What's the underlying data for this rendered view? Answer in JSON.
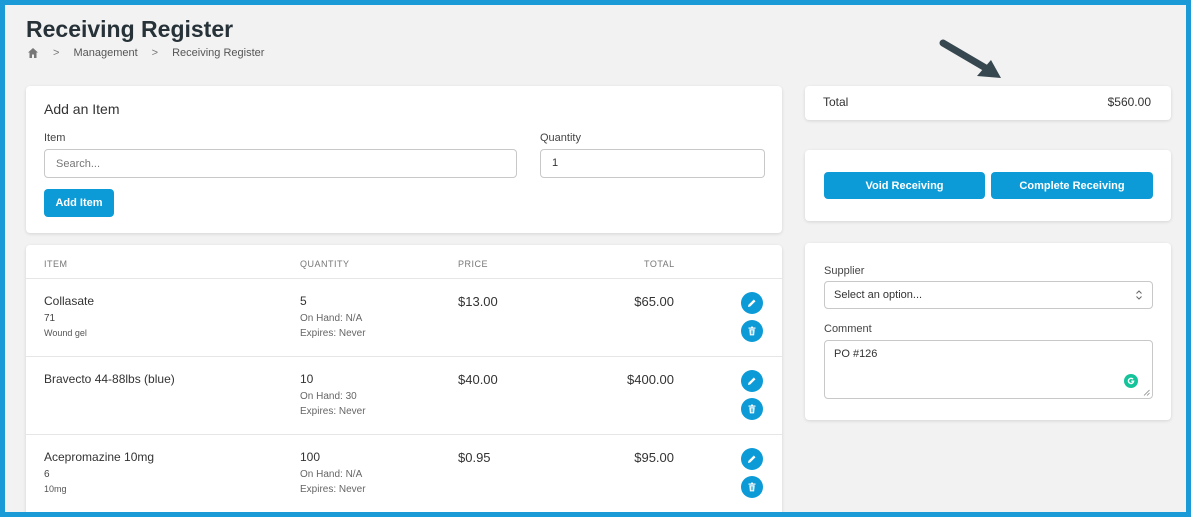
{
  "header": {
    "title": "Receiving Register",
    "breadcrumb": [
      "Management",
      "Receiving Register"
    ]
  },
  "add_item": {
    "title": "Add an Item",
    "item_label": "Item",
    "item_placeholder": "Search...",
    "quantity_label": "Quantity",
    "quantity_value": "1",
    "add_button": "Add Item"
  },
  "table": {
    "columns": [
      "ITEM",
      "QUANTITY",
      "PRICE",
      "TOTAL"
    ],
    "rows": [
      {
        "name": "Collasate",
        "code": "71",
        "desc": "Wound gel",
        "qty": "5",
        "on_hand": "On Hand: N/A",
        "expires": "Expires: Never",
        "price": "$13.00",
        "total": "$65.00"
      },
      {
        "name": "Bravecto 44-88lbs (blue)",
        "code": "",
        "desc": "",
        "qty": "10",
        "on_hand": "On Hand: 30",
        "expires": "Expires: Never",
        "price": "$40.00",
        "total": "$400.00"
      },
      {
        "name": "Acepromazine 10mg",
        "code": "6",
        "desc": "10mg",
        "qty": "100",
        "on_hand": "On Hand: N/A",
        "expires": "Expires: Never",
        "price": "$0.95",
        "total": "$95.00"
      }
    ]
  },
  "summary": {
    "total_label": "Total",
    "total_value": "$560.00"
  },
  "actions": {
    "void": "Void Receiving",
    "complete": "Complete Receiving"
  },
  "details": {
    "supplier_label": "Supplier",
    "supplier_value": "Select an option...",
    "comment_label": "Comment",
    "comment_value": "PO #126"
  },
  "colors": {
    "accent": "#0c9bd7",
    "frame": "#1a9ad6",
    "title": "#263238"
  },
  "icons": [
    "home-icon",
    "chevron-right-icon",
    "pointer-arrow-icon",
    "edit-icon",
    "delete-icon",
    "select-caret-icon",
    "grammarly-icon",
    "resize-handle-icon"
  ]
}
